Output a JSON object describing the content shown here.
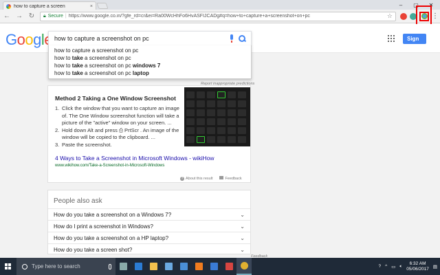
{
  "browser": {
    "tab_title": "how to capture a screen",
    "tab_close": "×",
    "secure_label": "Secure",
    "url": "https://www.google.co.in/?gfe_rd=cr&ei=Ra00WcHhFo6HvASFIJCADg#q=how+to+capture+a+screenshot+on+pc",
    "window_controls": {
      "minimize": "–",
      "maximize": "▢",
      "close": "✕"
    }
  },
  "google": {
    "logo_letters": [
      {
        "ch": "G",
        "color": "#4285f4"
      },
      {
        "ch": "o",
        "color": "#ea4335"
      },
      {
        "ch": "o",
        "color": "#fbbc05"
      },
      {
        "ch": "g",
        "color": "#4285f4"
      },
      {
        "ch": "l",
        "color": "#34a853"
      },
      {
        "ch": "e",
        "color": "#ea4335"
      }
    ],
    "query": "how to capture a screenshot on pc",
    "signin_label": "Sign"
  },
  "suggestions": [
    {
      "pre": "how to capture a screenshot on pc",
      "bold": "",
      "post": ""
    },
    {
      "pre": "how to ",
      "bold": "take",
      "post": " a screenshot on pc"
    },
    {
      "pre": "how to ",
      "bold": "take",
      "post": " a screenshot on pc windows 7"
    },
    {
      "pre": "how to ",
      "bold": "take",
      "post": " a screenshot on pc laptop"
    }
  ],
  "report_link": "Report inappropriate predictions",
  "featured": {
    "title": "Method 2 Taking a One Window Screenshot",
    "steps": [
      {
        "num": "1.",
        "text": "Click the window that you want to capture an image of. The One Window screenshot function will take a picture of the \"active\" window on your screen. ..."
      },
      {
        "num": "2.",
        "text": "Hold down Alt and press ⎙ PrtScr . An image of the window will be copied to the clipboard. ..."
      },
      {
        "num": "3.",
        "text": "Paste the screenshot."
      }
    ],
    "link": "4 Ways to Take a Screenshot in Microsoft Windows - wikiHow",
    "url": "www.wikihow.com/Take-a-Screenshot-in-Microsoft-Windows",
    "about": "About this result",
    "feedback": "Feedback"
  },
  "paa": {
    "title": "People also ask",
    "questions": [
      "How do you take a screenshot on a Windows 7?",
      "How do I print a screenshot in Windows?",
      "How do you take a screenshot on a HP laptop?",
      "How do you take a screen shot?"
    ],
    "feedback": "Feedback"
  },
  "taskbar": {
    "search_placeholder": "Type here to search",
    "time": "6:32 AM",
    "date": "05/06/2017",
    "apps": [
      {
        "name": "task-view",
        "color": "#8aa"
      },
      {
        "name": "edge",
        "color": "#2b7cd3"
      },
      {
        "name": "file-explorer",
        "color": "#f2c14e"
      },
      {
        "name": "store",
        "color": "#6aa9e0"
      },
      {
        "name": "mail",
        "color": "#4a8fd6"
      },
      {
        "name": "xampp",
        "color": "#f07c1f"
      },
      {
        "name": "photos",
        "color": "#3a7bd5"
      },
      {
        "name": "app-red",
        "color": "#d64541"
      },
      {
        "name": "chrome",
        "color": "#e0b030"
      }
    ]
  },
  "colors": {
    "annotation": "#e00000",
    "link": "#1a0dab",
    "url_green": "#006621",
    "signin_blue": "#4285f4"
  }
}
